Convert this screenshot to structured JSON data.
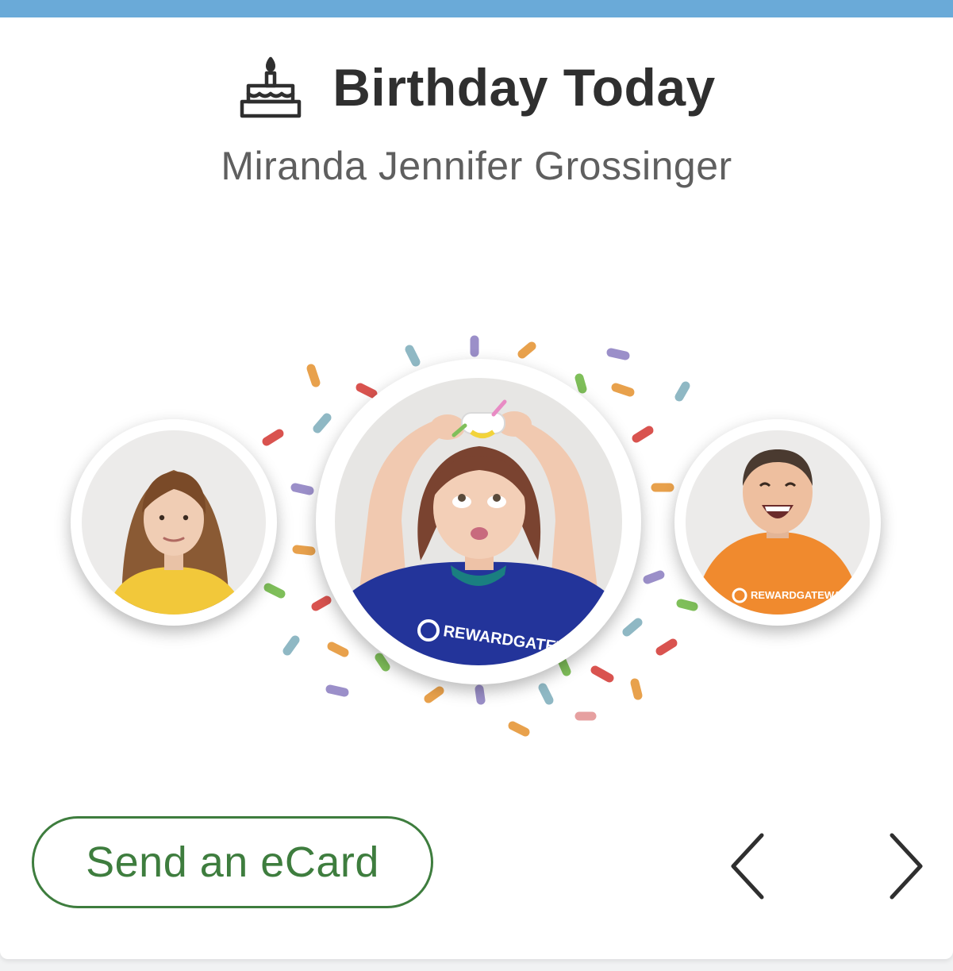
{
  "widget": {
    "title": "Birthday Today",
    "person_name": "Miranda Jennifer Grossinger",
    "icon": "birthday-cake-icon",
    "accent_color": "#6aaad8"
  },
  "carousel": {
    "people": [
      {
        "position": "previous",
        "shirt_color": "#f2c83a"
      },
      {
        "position": "current",
        "shirt_color": "#23349a",
        "shirt_text": "REWARDGATEWAY"
      },
      {
        "position": "next",
        "shirt_color": "#f08a2e",
        "shirt_text": "REWARDGATEWAY"
      }
    ],
    "prev_icon": "chevron-left-icon",
    "next_icon": "chevron-right-icon"
  },
  "actions": {
    "send_ecard_label": "Send an eCard",
    "button_color": "#3e7d3e"
  },
  "confetti_colors": [
    "#e8a14c",
    "#d9534f",
    "#9b8fc9",
    "#8fb8c4",
    "#7fbf5a",
    "#e6a0a0"
  ]
}
